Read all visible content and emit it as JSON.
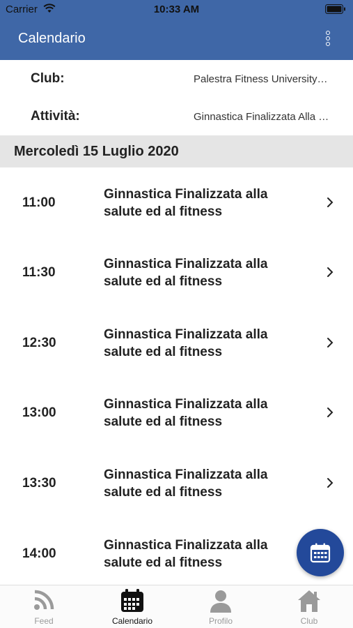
{
  "status_bar": {
    "carrier": "Carrier",
    "time": "10:33 AM"
  },
  "app_bar": {
    "title": "Calendario"
  },
  "filters": {
    "club_label": "Club:",
    "club_value": "Palestra Fitness University…",
    "activity_label": "Attività:",
    "activity_value": "Ginnastica Finalizzata Alla …"
  },
  "date_header": "Mercoledì 15 Luglio 2020",
  "sessions": [
    {
      "time": "11:00",
      "title": "Ginnastica Finalizzata alla salute ed al fitness"
    },
    {
      "time": "11:30",
      "title": "Ginnastica Finalizzata alla salute ed al fitness"
    },
    {
      "time": "12:30",
      "title": "Ginnastica Finalizzata alla salute ed al fitness"
    },
    {
      "time": "13:00",
      "title": "Ginnastica Finalizzata alla salute ed al fitness"
    },
    {
      "time": "13:30",
      "title": "Ginnastica Finalizzata alla salute ed al fitness"
    },
    {
      "time": "14:00",
      "title": "Ginnastica Finalizzata alla salute ed al fitness"
    }
  ],
  "tabs": [
    {
      "label": "Feed",
      "icon": "feed-icon",
      "active": false
    },
    {
      "label": "Calendario",
      "icon": "calendar-icon",
      "active": true
    },
    {
      "label": "Profilo",
      "icon": "profile-icon",
      "active": false
    },
    {
      "label": "Club",
      "icon": "home-icon",
      "active": false
    }
  ],
  "colors": {
    "primary": "#3f67a7",
    "fab": "#23499a",
    "date_header_bg": "#e5e5e5",
    "inactive_tab": "#9a9a9a"
  }
}
